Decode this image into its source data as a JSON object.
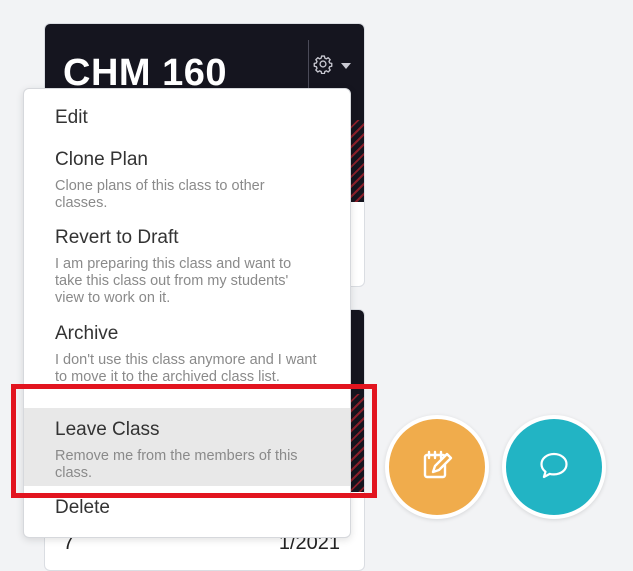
{
  "colors": {
    "banner": "#15151f",
    "menu_active_bg": "#e8e8e8",
    "highlight_border": "#e2141f",
    "fab_note": "#f0ac4c",
    "fab_chat": "#22b4c4"
  },
  "class_card": {
    "title": "CHM 160",
    "settings_icon": "gear-icon",
    "dropdown_icon": "caret-down-icon"
  },
  "second_card": {
    "footer_left": "7",
    "footer_right": "1/2021"
  },
  "menu": {
    "items": [
      {
        "label": "Edit",
        "description": ""
      },
      {
        "label": "Clone Plan",
        "description": "Clone plans of this class to other classes."
      },
      {
        "label": "Revert to Draft",
        "description": "I am preparing this class and want to take this class out from my students' view to work on it."
      },
      {
        "label": "Archive",
        "description": "I don't use this class anymore and I want to move it to the archived class list."
      },
      {
        "label": "Leave Class",
        "description": "Remove me from the members of this class."
      },
      {
        "label": "Delete",
        "description": ""
      }
    ],
    "active_index": 4
  },
  "fabs": {
    "note_icon": "edit-note-icon",
    "chat_icon": "chat-bubble-icon"
  }
}
